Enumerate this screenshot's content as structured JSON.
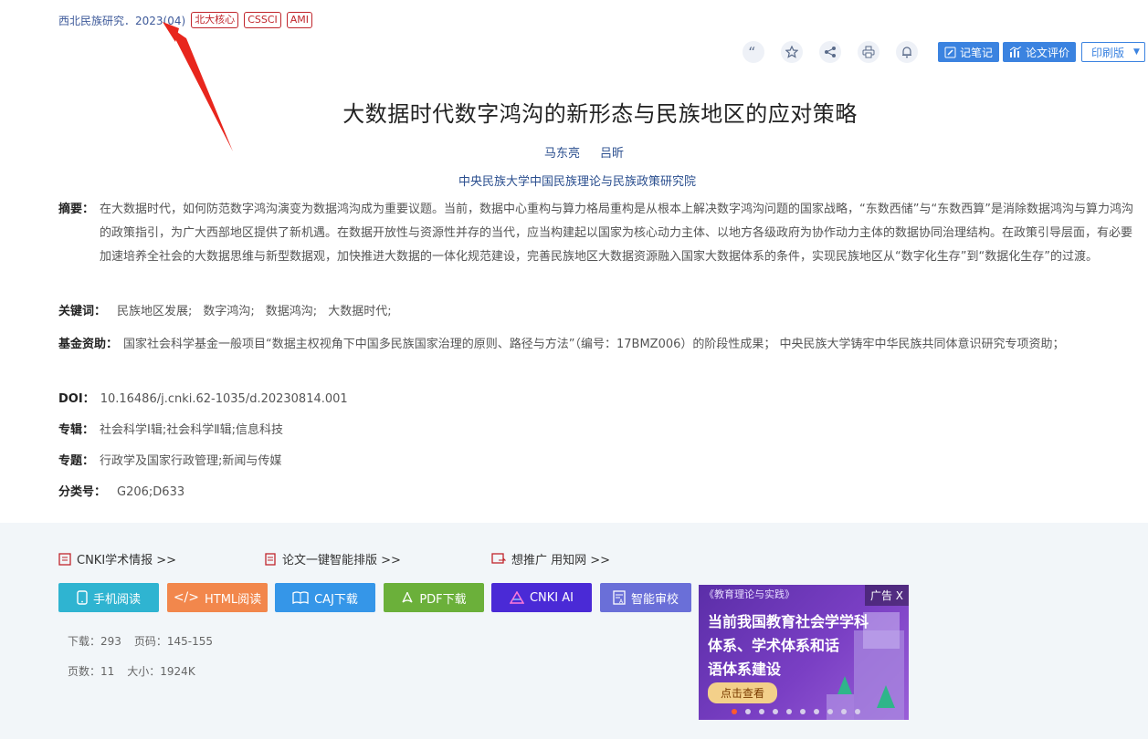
{
  "source": {
    "journal_issue": "西北民族研究．2023(04)",
    "badges": [
      "北大核心",
      "CSSCI",
      "AMI"
    ]
  },
  "toolbar": {
    "icons": [
      "quote-icon",
      "star-icon",
      "share-icon",
      "print-icon",
      "bell-icon"
    ],
    "note_label": "记笔记",
    "eval_label": "论文评价",
    "print_label": "印刷版"
  },
  "article": {
    "title": "大数据时代数字鸿沟的新形态与民族地区的应对策略",
    "authors": [
      "马东亮",
      "吕昕"
    ],
    "affiliation": "中央民族大学中国民族理论与民族政策研究院",
    "abstract_label": "摘要：",
    "abstract": "在大数据时代，如何防范数字鸿沟演变为数据鸿沟成为重要议题。当前，数据中心重构与算力格局重构是从根本上解决数字鸿沟问题的国家战略，“东数西储”与“东数西算”是消除数据鸿沟与算力鸿沟的政策指引，为广大西部地区提供了新机遇。在数据开放性与资源性并存的当代，应当构建起以国家为核心动力主体、以地方各级政府为协作动力主体的数据协同治理结构。在政策引导层面，有必要加速培养全社会的大数据思维与新型数据观，加快推进大数据的一体化规范建设，完善民族地区大数据资源融入国家大数据体系的条件，实现民族地区从“数字化生存”到“数据化生存”的过渡。",
    "keywords_label": "关键词：",
    "keywords": [
      "民族地区发展;",
      "数字鸿沟;",
      "数据鸿沟;",
      "大数据时代;"
    ],
    "fund_label": "基金资助：",
    "fund": "国家社会科学基金一般项目“数据主权视角下中国多民族国家治理的原则、路径与方法”（编号：17BMZ006）的阶段性成果；  中央民族大学铸牢中华民族共同体意识研究专项资助；",
    "doi_label": "DOI：",
    "doi": "10.16486/j.cnki.62-1035/d.20230814.001",
    "series_label": "专辑：",
    "series": "社会科学Ⅰ辑;社会科学Ⅱ辑;信息科技",
    "topic_label": "专题：",
    "topic": "行政学及国家行政管理;新闻与传媒",
    "class_label": "分类号：",
    "class": "G206;D633"
  },
  "promos": [
    "CNKI学术情报 >>",
    "论文一键智能排版 >>",
    "想推广 用知网 >>"
  ],
  "actions": [
    {
      "label": "手机阅读",
      "color": "#2fb4d1"
    },
    {
      "label": "HTML阅读",
      "color": "#f2874c"
    },
    {
      "label": "CAJ下载",
      "color": "#3596e8"
    },
    {
      "label": "PDF下载",
      "color": "#6bb03a"
    },
    {
      "label": "CNKI AI",
      "color": "#4a2ad6"
    },
    {
      "label": "智能审校",
      "color": "#6a6fd8"
    }
  ],
  "stats": {
    "downloads": "下载：293",
    "pages_range": "页码：145-155",
    "page_count": "页数：11",
    "size": "大小：1924K"
  },
  "ad": {
    "source": "《教育理论与实践》",
    "tag": "广告 X",
    "line1": "当前我国教育社会学学科",
    "line2": "体系、学术体系和话",
    "line3": "语体系建设",
    "cta": "点击查看"
  }
}
